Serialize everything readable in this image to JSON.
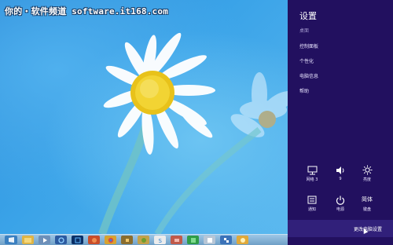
{
  "desktop": {
    "watermark": "你的・软件频道 software.it168.com"
  },
  "taskbar": {
    "icons": [
      "start-icon",
      "explorer-icon",
      "media-icon",
      "ie-icon",
      "photoshop-icon",
      "app-icon",
      "chrome-icon",
      "app-icon",
      "app-icon",
      "skype-icon",
      "app-icon",
      "green-app-icon",
      "app-icon",
      "app-icon",
      "app-icon"
    ]
  },
  "settings": {
    "title": "设置",
    "items": [
      {
        "label": "桌面"
      },
      {
        "label": "控制面板"
      },
      {
        "label": "个性化"
      },
      {
        "label": "电脑信息"
      },
      {
        "label": "帮助"
      }
    ],
    "quick": {
      "network": {
        "label": "网络 3"
      },
      "volume": {
        "label": "9"
      },
      "brightness": {
        "label": "亮度"
      },
      "notifications": {
        "label": "通知"
      },
      "power": {
        "label": "电源"
      },
      "keyboard": {
        "glyph": "简体",
        "label": "键盘"
      }
    },
    "change_pc_settings": "更改电脑设置"
  },
  "colors": {
    "charms_bg": "#22105f",
    "charms_footer": "#31207a",
    "wallpaper": "#2f9ae0"
  }
}
